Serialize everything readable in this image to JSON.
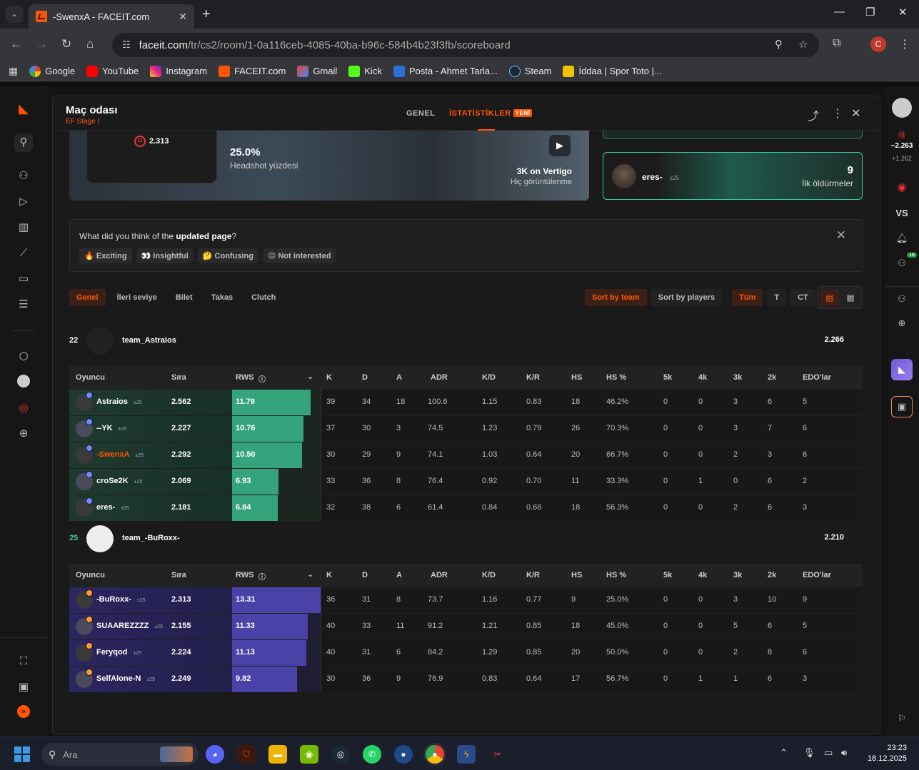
{
  "browser": {
    "tab_title": "-SwenxA - FACEIT.com",
    "url_host": "faceit.com",
    "url_path": "/tr/cs2/room/1-0a116ceb-4085-40ba-b96c-584b4b23f3fb/scoreboard",
    "profile_initial": "C",
    "bookmarks": [
      "Google",
      "YouTube",
      "Instagram",
      "FACEIT.com",
      "Gmail",
      "Kick",
      "Posta - Ahmet Tarla...",
      "Steam",
      "İddaa | Spor Toto |..."
    ]
  },
  "right_sidebar": {
    "elo": "2.263",
    "elo_prefix": "~",
    "elo_change": "+1.262",
    "vs": "VS",
    "friends_count": "18"
  },
  "panel": {
    "title": "Maç odası",
    "subtitle": "EF Stage I",
    "tabs": [
      "GENEL",
      "İSTATİSTİKLER"
    ],
    "new_badge": "YENİ"
  },
  "highlight": {
    "elo": "2.313",
    "hs_value": "25.0%",
    "hs_label": "Headshot yüzdesi",
    "clip_title": "3K on Vertigo",
    "clip_sub": "Hiç görüntülenme"
  },
  "first_kill": {
    "player": "eres-",
    "tag": "±25",
    "value": "9",
    "label": "İlk öldürmeler"
  },
  "feedback": {
    "question_pre": "What did you think of the ",
    "question_bold": "updated page",
    "question_post": "?",
    "options": [
      "🔥 Exciting",
      "👀 Insightful",
      "🤔 Confusing",
      "😣 Not interested"
    ]
  },
  "subtabs": [
    "Genel",
    "İleri seviye",
    "Bilet",
    "Takas",
    "Clutch"
  ],
  "filters": [
    "Sort by team",
    "Sort by players",
    "Tüm",
    "T",
    "CT"
  ],
  "columns": [
    "Oyuncu",
    "Sıra",
    "RWS",
    "K",
    "D",
    "A",
    "ADR",
    "K/D",
    "K/R",
    "HS",
    "HS %",
    "5k",
    "4k",
    "3k",
    "2k",
    "EDO'lar"
  ],
  "rws_max": 13.31,
  "teams": [
    {
      "number": "22",
      "name": "team_Astraios",
      "elo": "2.266",
      "color": "#3dcf9c",
      "players": [
        {
          "name": "Astraios",
          "tag": "±25",
          "elo": "2.562",
          "rws": "11.79",
          "rws_num": 11.79,
          "k": "39",
          "d": "34",
          "a": "18",
          "adr": "100.6",
          "kd": "1.15",
          "kr": "0.83",
          "hs": "18",
          "hsp": "46.2%",
          "k5": "0",
          "k4": "0",
          "k3": "3",
          "k2": "6",
          "edo": "5",
          "self": false
        },
        {
          "name": "--YK",
          "tag": "±25",
          "elo": "2.227",
          "rws": "10.76",
          "rws_num": 10.76,
          "k": "37",
          "d": "30",
          "a": "3",
          "adr": "74.5",
          "kd": "1.23",
          "kr": "0.79",
          "hs": "26",
          "hsp": "70.3%",
          "k5": "0",
          "k4": "0",
          "k3": "3",
          "k2": "7",
          "edo": "6",
          "self": false
        },
        {
          "name": "-SwenxA",
          "tag": "±25",
          "elo": "2.292",
          "rws": "10.50",
          "rws_num": 10.5,
          "k": "30",
          "d": "29",
          "a": "9",
          "adr": "74.1",
          "kd": "1.03",
          "kr": "0.64",
          "hs": "20",
          "hsp": "66.7%",
          "k5": "0",
          "k4": "0",
          "k3": "2",
          "k2": "3",
          "edo": "6",
          "self": true
        },
        {
          "name": "croSe2K",
          "tag": "±25",
          "elo": "2.069",
          "rws": "6.93",
          "rws_num": 6.93,
          "k": "33",
          "d": "36",
          "a": "8",
          "adr": "76.4",
          "kd": "0.92",
          "kr": "0.70",
          "hs": "11",
          "hsp": "33.3%",
          "k5": "0",
          "k4": "1",
          "k3": "0",
          "k2": "6",
          "edo": "2",
          "self": false
        },
        {
          "name": "eres-",
          "tag": "±25",
          "elo": "2.181",
          "rws": "6.84",
          "rws_num": 6.84,
          "k": "32",
          "d": "38",
          "a": "6",
          "adr": "61.4",
          "kd": "0.84",
          "kr": "0.68",
          "hs": "18",
          "hsp": "56.3%",
          "k5": "0",
          "k4": "0",
          "k3": "2",
          "k2": "6",
          "edo": "3",
          "self": false
        }
      ]
    },
    {
      "number": "25",
      "name": "team_-BuRoxx-",
      "elo": "2.210",
      "color": "#5b4fd0",
      "players": [
        {
          "name": "-BuRoxx-",
          "tag": "±25",
          "elo": "2.313",
          "rws": "13.31",
          "rws_num": 13.31,
          "k": "36",
          "d": "31",
          "a": "8",
          "adr": "73.7",
          "kd": "1.16",
          "kr": "0.77",
          "hs": "9",
          "hsp": "25.0%",
          "k5": "0",
          "k4": "0",
          "k3": "3",
          "k2": "10",
          "edo": "9",
          "self": false
        },
        {
          "name": "SUAAREZZZZ",
          "tag": "±25",
          "elo": "2.155",
          "rws": "11.33",
          "rws_num": 11.33,
          "k": "40",
          "d": "33",
          "a": "11",
          "adr": "91.2",
          "kd": "1.21",
          "kr": "0.85",
          "hs": "18",
          "hsp": "45.0%",
          "k5": "0",
          "k4": "0",
          "k3": "5",
          "k2": "6",
          "edo": "5",
          "self": false
        },
        {
          "name": "Feryqod",
          "tag": "±25",
          "elo": "2.224",
          "rws": "11.13",
          "rws_num": 11.13,
          "k": "40",
          "d": "31",
          "a": "6",
          "adr": "84.2",
          "kd": "1.29",
          "kr": "0.85",
          "hs": "20",
          "hsp": "50.0%",
          "k5": "0",
          "k4": "0",
          "k3": "2",
          "k2": "8",
          "edo": "6",
          "self": false
        },
        {
          "name": "SelfAlone-N",
          "tag": "±25",
          "elo": "2.249",
          "rws": "9.82",
          "rws_num": 9.82,
          "k": "30",
          "d": "36",
          "a": "9",
          "adr": "76.9",
          "kd": "0.83",
          "kr": "0.64",
          "hs": "17",
          "hsp": "56.7%",
          "k5": "0",
          "k4": "1",
          "k3": "1",
          "k2": "6",
          "edo": "3",
          "self": false
        }
      ]
    }
  ],
  "taskbar": {
    "search_placeholder": "Ara",
    "time": "23:23",
    "date": "18.12.2025"
  }
}
